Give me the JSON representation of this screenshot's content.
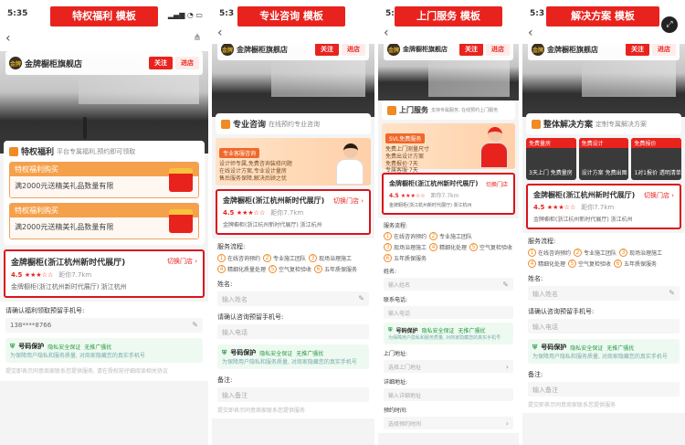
{
  "banners": [
    "特权福利 模板",
    "专业咨询 模板",
    "上门服务 模板",
    "解决方案 模板"
  ],
  "status_time": "5:35",
  "status_time_short": "5:3",
  "shop": {
    "name": "金牌橱柜旗舰店",
    "logo": "金牌",
    "follow": "关注",
    "enter": "进店"
  },
  "p1": {
    "priv_title": "特权福利",
    "priv_sub": "平台专属福利,预约即可领取",
    "coupons": [
      {
        "head": "特权福利购买",
        "body": "满2000元送精美礼品数量有限"
      },
      {
        "head": "特权福利购买",
        "body": "满2000元送精美礼品数量有限"
      }
    ],
    "store": {
      "name": "金牌橱柜(浙江杭州新时代展厅)",
      "switch": "切换门店 ›",
      "rating": "4.5 ★★★☆☆",
      "dist": "距你7.7km",
      "addr": "金牌橱柜(浙江杭州新时代展厅) 浙江杭州"
    },
    "phone_label": "请确认福利领取预留手机号:",
    "phone_value": "138****8766",
    "protect": {
      "title": "号码保护",
      "t1": "隐私安全保证",
      "t2": "无推广骚扰",
      "desc": "为保障用户隐私和服务质量, 对商家隐藏您的真实手机号"
    },
    "foot": "提交即表示同意商家联系您提供服务, 请在授权前仔细阅读相关协议"
  },
  "p2": {
    "title": "专业咨询",
    "sub": "在线预约专业咨询",
    "promo_tag": "专业客服咨询",
    "promo_lines": [
      "设计师专属,免费咨询装修问题",
      "在线设计方案,专业设计量房",
      "售后服务保障,解决后顾之忧"
    ],
    "store": {
      "name": "金牌橱柜(浙江杭州新时代展厅)",
      "switch": "切换门店 ›",
      "rating": "4.5 ★★★☆☆",
      "dist": "距你7.7km",
      "addr": "金牌橱柜(浙江杭州新时代展厅) 浙江杭州"
    },
    "flow_label": "服务流程:",
    "steps": [
      {
        "n": "1",
        "t": "在线咨询预约"
      },
      {
        "n": "2",
        "t": "专业施工团队"
      },
      {
        "n": "3",
        "t": "现场治理施工"
      },
      {
        "n": "4",
        "t": "精细化质量处理"
      },
      {
        "n": "5",
        "t": "空气复检验收"
      },
      {
        "n": "6",
        "t": "五年质保服务"
      }
    ],
    "name_label": "姓名:",
    "name_ph": "输入姓名",
    "phone_label": "请确认咨询预留手机号:",
    "phone_ph": "输入电话",
    "protect": {
      "title": "号码保护",
      "t1": "隐私安全保证",
      "t2": "无推广骚扰",
      "desc": "为保障用户隐私和服务质量, 对商家隐藏您的真实手机号"
    },
    "note_label": "备注:",
    "note_ph": "输入备注",
    "foot": "提交即表示同意商家联系您提供服务"
  },
  "p3": {
    "title": "上门服务",
    "sub": "支持专属服务, 在线预约上门服务",
    "promo_tag": "SVL免费服务",
    "promo_lines": [
      "免费上门测量尺寸",
      "免费出设计方案",
      "免费报价·7天",
      "专属客服·7天"
    ],
    "store": {
      "name": "金牌橱柜(浙江杭州新时代展厅)",
      "switch": "切换门店",
      "rating": "4.5 ★★★☆☆",
      "dist": "距你7.7km",
      "addr": "金牌橱柜(浙江杭州新时代展厅) 浙江杭州"
    },
    "flow_label": "服务流程:",
    "steps": [
      {
        "n": "1",
        "t": "在线咨询预约"
      },
      {
        "n": "2",
        "t": "专业施工团队"
      },
      {
        "n": "3",
        "t": "现场治理施工"
      },
      {
        "n": "4",
        "t": "精细化处理"
      },
      {
        "n": "5",
        "t": "空气复检验收"
      },
      {
        "n": "6",
        "t": "五年质保服务"
      }
    ],
    "name_label": "姓名:",
    "name_ph": "输入姓名",
    "phone_label": "联系电话:",
    "phone_ph": "输入电话",
    "protect": {
      "title": "号码保护",
      "t1": "隐私安全保证",
      "t2": "无推广骚扰",
      "desc": "为保障用户隐私和服务质量, 对商家隐藏您的真实手机号"
    },
    "addr_label": "上门地址:",
    "addr_ph": "选择上门地址",
    "detail_label": "详细地址:",
    "detail_ph": "输入详细地址",
    "time_label": "预约时间:",
    "time_ph": "选择预约时间"
  },
  "p4": {
    "title": "整体解决方案",
    "sub": "定制专属解决方案",
    "plans": [
      {
        "tag": "免费量房",
        "cap": "3天上门 免费量房"
      },
      {
        "tag": "免费设计",
        "cap": "设计方案 免费出图"
      },
      {
        "tag": "免费报价",
        "cap": "1对1报价 透明清单"
      }
    ],
    "store": {
      "name": "金牌橱柜(浙江杭州新时代展厅)",
      "switch": "切换门店 ›",
      "rating": "4.5 ★★★☆☆",
      "dist": "距你7.7km",
      "addr": "金牌橱柜(浙江杭州新时代展厅) 浙江杭州"
    },
    "flow_label": "服务流程:",
    "steps": [
      {
        "n": "1",
        "t": "在线咨询预约"
      },
      {
        "n": "2",
        "t": "专业施工团队"
      },
      {
        "n": "3",
        "t": "现场治理施工"
      },
      {
        "n": "4",
        "t": "精细化处理"
      },
      {
        "n": "5",
        "t": "空气复检验收"
      },
      {
        "n": "6",
        "t": "五年质保服务"
      }
    ],
    "name_label": "姓名:",
    "name_ph": "输入姓名",
    "phone_label": "请确认咨询预留手机号:",
    "phone_ph": "输入电话",
    "protect": {
      "title": "号码保护",
      "t1": "隐私安全保证",
      "t2": "无推广骚扰",
      "desc": "为保障用户隐私和服务质量, 对商家隐藏您的真实手机号"
    },
    "note_label": "备注:",
    "note_ph": "输入备注",
    "foot": "提交即表示同意商家联系您提供服务"
  },
  "colors": {
    "accent": "#e8231e",
    "orange": "#f08a24",
    "green": "#2a9a46"
  }
}
